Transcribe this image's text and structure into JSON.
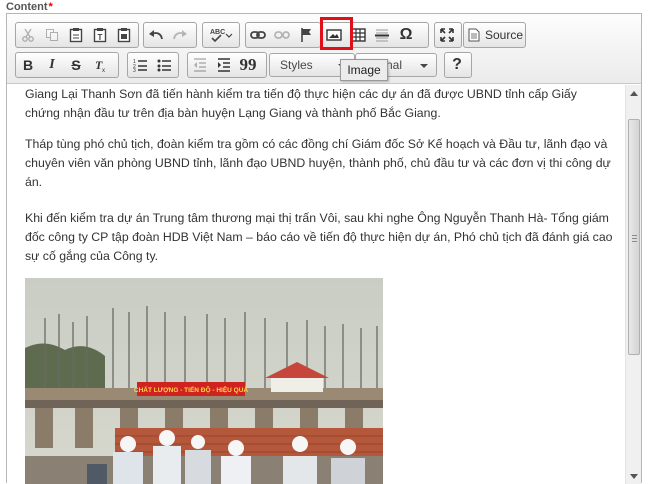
{
  "field": {
    "label": "Content",
    "required_mark": "*"
  },
  "toolbar": {
    "row1": {
      "clipboard": [
        "cut-icon",
        "copy-icon",
        "paste-icon",
        "paste-text-icon",
        "paste-word-icon"
      ],
      "history": [
        "undo-icon",
        "redo-icon"
      ],
      "spellcheck": "spellcheck-icon",
      "links": [
        "link-icon",
        "unlink-icon",
        "anchor-icon"
      ],
      "insert": [
        "image-icon",
        "table-icon",
        "horizontal-line-icon",
        "special-char-icon"
      ],
      "tools": [
        "maximize-icon"
      ],
      "source_label": "Source"
    },
    "row2": {
      "bold_label": "B",
      "italic_label": "I",
      "strike_label": "S",
      "remove_format": "remove-format-icon",
      "lists": [
        "numbered-list-icon",
        "bulleted-list-icon"
      ],
      "indent": [
        "outdent-icon",
        "indent-icon"
      ],
      "blockquote_label": "99",
      "styles_label": "Styles",
      "format_label": "nal",
      "help_label": "?"
    }
  },
  "tooltip": {
    "text": "Image"
  },
  "highlight_color": "#e0101a",
  "content": {
    "paragraphs": [
      "Giang Lại Thanh Sơn đã tiến hành kiểm tra tiến độ thực hiện các dự án đã được UBND tỉnh cấp Giấy chứng nhận đầu tư trên địa bàn huyện Lạng Giang và thành phố Bắc Giang.",
      "Tháp tùng phó chủ tịch, đoàn kiểm tra gồm có các đồng chí Giám đốc Sở Kế hoạch và Đầu tư, lãnh đạo và chuyên viên văn phòng UBND tỉnh, lãnh đạo UBND huyện, thành phố, chủ đầu tư và các đơn vị thi công dự án.",
      "Khi đến kiểm tra dự án Trung tâm thương mại thị trấn Vôi, sau khi nghe Ông Nguyễn Thanh Hà- Tổng giám đốc công ty CP tập đoàn HDB Việt Nam – báo cáo về tiến độ thực hiện dự án, Phó chủ tịch đã đánh giá cao sự cố gắng của Công ty."
    ],
    "photo_banner": "CHẤT LƯỢNG - TIẾN ĐỘ - HIỆU QUẢ"
  }
}
